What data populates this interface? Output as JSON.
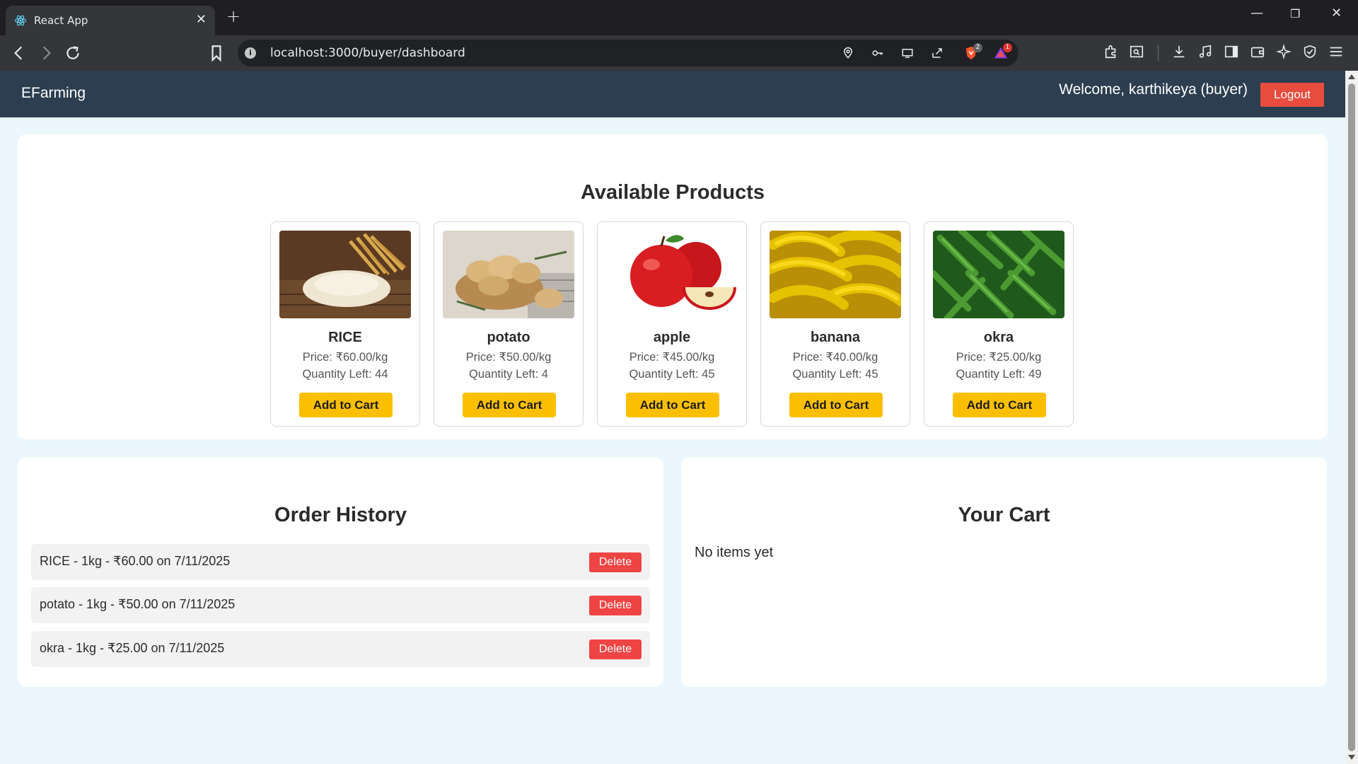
{
  "browser": {
    "tab_title": "React App",
    "tab_close": "✕",
    "new_tab": "+",
    "window_minimize": "—",
    "window_restore": "❐",
    "window_close": "✕",
    "url_host": "localhost",
    "url_path": ":3000/buyer/dashboard",
    "brave_badge": "2",
    "alert_badge": "1"
  },
  "navbar": {
    "brand": "EFarming",
    "welcome": "Welcome, karthikeya (buyer)",
    "logout_label": "Logout"
  },
  "products": {
    "title": "Available Products",
    "items": [
      {
        "name": "RICE",
        "price": "Price: ₹60.00/kg",
        "qty": "Quantity Left: 44",
        "button": "Add to Cart"
      },
      {
        "name": "potato",
        "price": "Price: ₹50.00/kg",
        "qty": "Quantity Left: 4",
        "button": "Add to Cart"
      },
      {
        "name": "apple",
        "price": "Price: ₹45.00/kg",
        "qty": "Quantity Left: 45",
        "button": "Add to Cart"
      },
      {
        "name": "banana",
        "price": "Price: ₹40.00/kg",
        "qty": "Quantity Left: 45",
        "button": "Add to Cart"
      },
      {
        "name": "okra",
        "price": "Price: ₹25.00/kg",
        "qty": "Quantity Left: 49",
        "button": "Add to Cart"
      }
    ]
  },
  "orders": {
    "title": "Order History",
    "items": [
      {
        "text": "RICE - 1kg - ₹60.00 on 7/11/2025",
        "button": "Delete"
      },
      {
        "text": "potato - 1kg - ₹50.00 on 7/11/2025",
        "button": "Delete"
      },
      {
        "text": "okra - 1kg - ₹25.00 on 7/11/2025",
        "button": "Delete"
      }
    ]
  },
  "cart": {
    "title": "Your Cart",
    "empty_text": "No items yet"
  },
  "colors": {
    "navbar": "#2c3e50",
    "logout": "#e74c3c",
    "add_to_cart": "#fcbf00",
    "delete": "#ef4444",
    "page_bg": "#ebf7fc"
  }
}
